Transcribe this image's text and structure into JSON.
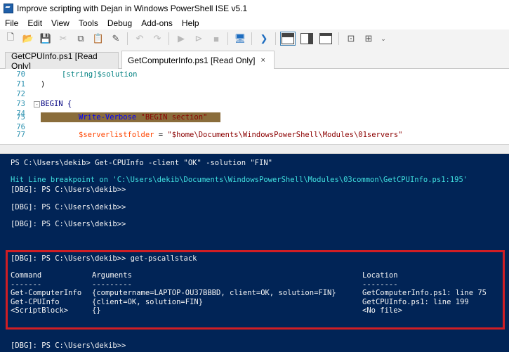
{
  "window": {
    "title": "Improve scripting with Dejan in Windows PowerShell ISE v5.1",
    "icon": "powershell-ise-icon"
  },
  "menu": [
    "File",
    "Edit",
    "View",
    "Tools",
    "Debug",
    "Add-ons",
    "Help"
  ],
  "toolbar": {
    "icons": [
      "new-file-icon",
      "open-folder-icon",
      "save-icon",
      "cut-icon",
      "copy-icon",
      "paste-icon",
      "clear-console-icon",
      "undo-icon",
      "redo-icon",
      "run-icon",
      "run-selection-icon",
      "stop-icon",
      "remote-powershell-icon",
      "powershell-console-icon",
      "layout-top-icon",
      "layout-right-icon",
      "layout-maximize-icon",
      "show-script-pane-icon",
      "show-commands-icon"
    ]
  },
  "tabs": [
    {
      "label": "GetCPUInfo.ps1 [Read Only]",
      "active": false
    },
    {
      "label": "GetComputerInfo.ps1 [Read Only]",
      "active": true,
      "close": "×"
    }
  ],
  "editor": {
    "lines": [
      {
        "num": "70",
        "text": "[string]$solution"
      },
      {
        "num": "71",
        "text": ")"
      },
      {
        "num": "72",
        "text": ""
      },
      {
        "num": "73",
        "text": "BEGIN {"
      },
      {
        "num": "74",
        "text": ""
      },
      {
        "num": "75",
        "cmd": "Write-Verbose",
        "str": "\"BEGIN section\""
      },
      {
        "num": "76",
        "text": ""
      },
      {
        "num": "77",
        "var": "$serverlistfolder",
        "op": " = ",
        "str": "\"$home\\Documents\\WindowsPowerShell\\Modules\\01servers\""
      }
    ],
    "fold_symbol": "-"
  },
  "console": {
    "lines": [
      "PS C:\\Users\\dekib> Get-CPUInfo -client \"OK\" -solution \"FIN\"",
      "Hit Line breakpoint on 'C:\\Users\\dekib\\Documents\\WindowsPowerShell\\Modules\\03common\\GetCPUInfo.ps1:195'",
      "[DBG]: PS C:\\Users\\dekib>>",
      "[DBG]: PS C:\\Users\\dekib>>",
      "[DBG]: PS C:\\Users\\dekib>>",
      "[DBG]: PS C:\\Users\\dekib>> get-pscallstack"
    ],
    "callstack": {
      "headers": [
        "Command",
        "Arguments",
        "Location"
      ],
      "underline": [
        "-------",
        "---------",
        "--------"
      ],
      "rows": [
        [
          "Get-ComputerInfo",
          "{computername=LAPTOP-OU37BBBD, client=OK, solution=FIN}",
          "GetComputerInfo.ps1: line 75"
        ],
        [
          "Get-CPUInfo",
          "{client=OK, solution=FIN}",
          "GetCPUInfo.ps1: line 199"
        ],
        [
          "<ScriptBlock>",
          "{}",
          "<No file>"
        ]
      ]
    },
    "last_prompt": "[DBG]: PS C:\\Users\\dekib>>"
  },
  "colors": {
    "console_bg": "#012456",
    "highlight": "#d01e24",
    "breakpoint": "#8a6d3b"
  }
}
